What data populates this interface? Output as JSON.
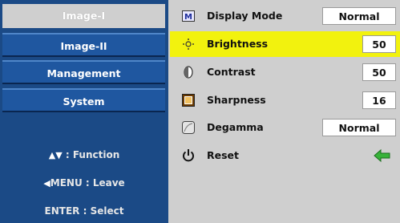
{
  "menu": {
    "tabs": [
      {
        "label": "Image-I",
        "active": true
      },
      {
        "label": "Image-II",
        "active": false
      },
      {
        "label": "Management",
        "active": false
      },
      {
        "label": "System",
        "active": false
      }
    ],
    "help": {
      "function": ": Function",
      "leave": "MENU : Leave",
      "select": "ENTER : Select"
    }
  },
  "settings": [
    {
      "label": "Display Mode",
      "value": "Normal",
      "icon": "display-mode-icon"
    },
    {
      "label": "Brightness",
      "value": "50",
      "icon": "brightness-icon",
      "selected": true
    },
    {
      "label": "Contrast",
      "value": "50",
      "icon": "contrast-icon"
    },
    {
      "label": "Sharpness",
      "value": "16",
      "icon": "sharpness-icon"
    },
    {
      "label": "Degamma",
      "value": "Normal",
      "icon": "degamma-icon"
    },
    {
      "label": "Reset",
      "icon": "power-icon",
      "action_icon": "green-arrow-icon"
    }
  ],
  "colors": {
    "sidebar": "#1b4a86",
    "tab": "#1f57a0",
    "highlight": "#f2f20e",
    "panel": "#cfcfcf"
  }
}
